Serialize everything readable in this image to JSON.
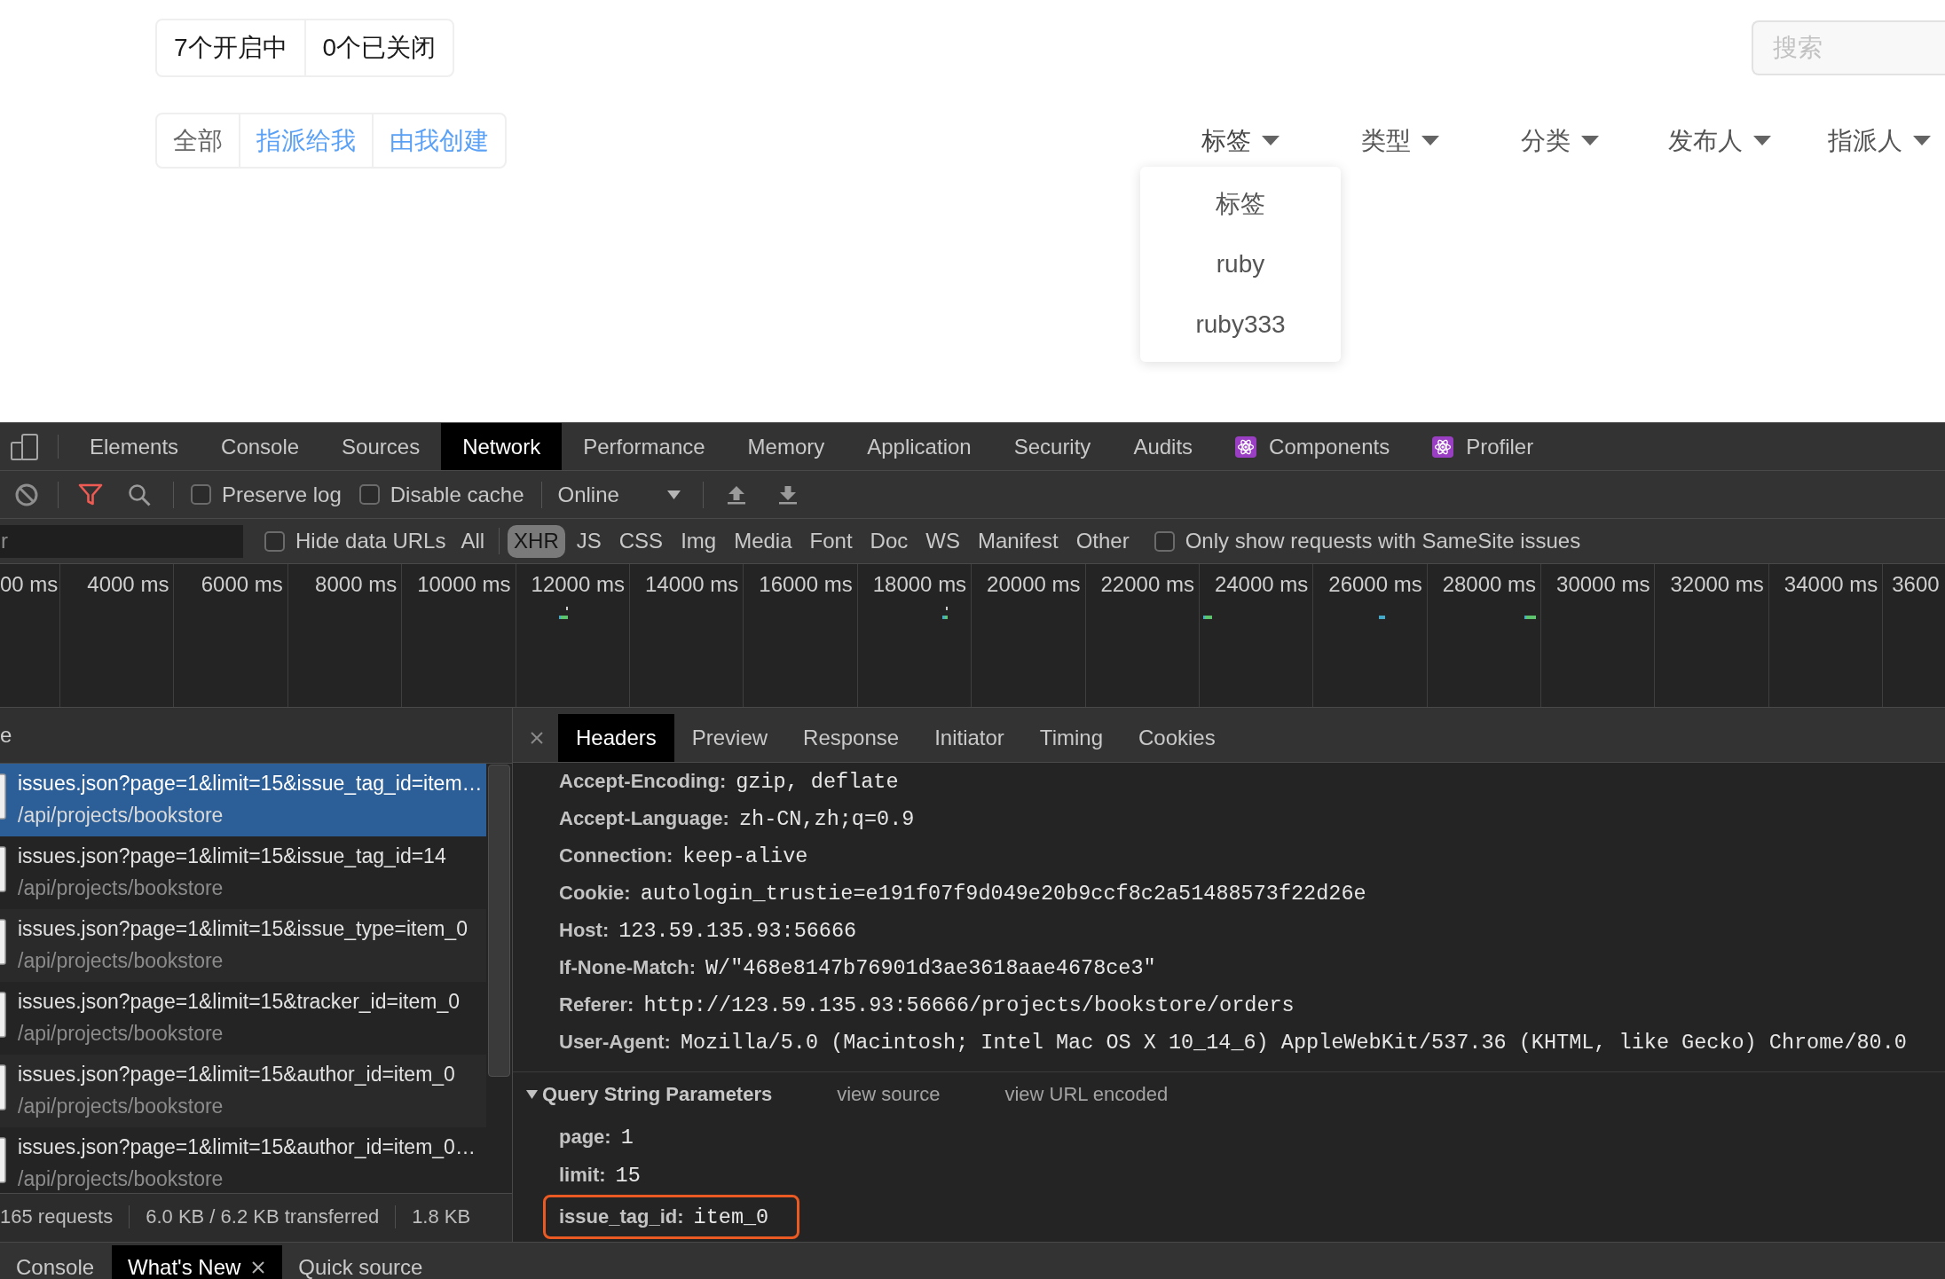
{
  "app": {
    "issue_counts": [
      "7个开启中",
      "0个已关闭"
    ],
    "search": {
      "placeholder": "搜索"
    },
    "scopes": [
      {
        "label": "全部",
        "selected": true
      },
      {
        "label": "指派给我",
        "selected": false
      },
      {
        "label": "由我创建",
        "selected": false
      }
    ],
    "filters": [
      {
        "label": "标签",
        "expanded": true,
        "options": [
          "标签",
          "ruby",
          "ruby333"
        ]
      },
      {
        "label": "类型",
        "expanded": false
      },
      {
        "label": "分类",
        "expanded": false
      },
      {
        "label": "发布人",
        "expanded": false
      },
      {
        "label": "指派人",
        "expanded": false
      }
    ]
  },
  "devtools": {
    "panel_tabs": [
      {
        "label": "Elements",
        "kind": "builtin",
        "selected": false
      },
      {
        "label": "Console",
        "kind": "builtin",
        "selected": false
      },
      {
        "label": "Sources",
        "kind": "builtin",
        "selected": false
      },
      {
        "label": "Network",
        "kind": "builtin",
        "selected": true
      },
      {
        "label": "Performance",
        "kind": "builtin",
        "selected": false
      },
      {
        "label": "Memory",
        "kind": "builtin",
        "selected": false
      },
      {
        "label": "Application",
        "kind": "builtin",
        "selected": false
      },
      {
        "label": "Security",
        "kind": "builtin",
        "selected": false
      },
      {
        "label": "Audits",
        "kind": "builtin",
        "selected": false
      },
      {
        "label": "Components",
        "kind": "extension",
        "selected": false
      },
      {
        "label": "Profiler",
        "kind": "extension",
        "selected": false
      }
    ],
    "toolbar": {
      "preserve_log": {
        "label": "Preserve log",
        "checked": false
      },
      "disable_cache": {
        "label": "Disable cache",
        "checked": false
      },
      "throttling": "Online"
    },
    "filter_bar": {
      "placeholder": "r",
      "hide_data_urls": {
        "label": "Hide data URLs",
        "checked": false
      },
      "types": [
        {
          "label": "All",
          "selected": false
        },
        {
          "label": "XHR",
          "selected": true
        },
        {
          "label": "JS",
          "selected": false
        },
        {
          "label": "CSS",
          "selected": false
        },
        {
          "label": "Img",
          "selected": false
        },
        {
          "label": "Media",
          "selected": false
        },
        {
          "label": "Font",
          "selected": false
        },
        {
          "label": "Doc",
          "selected": false
        },
        {
          "label": "WS",
          "selected": false
        },
        {
          "label": "Manifest",
          "selected": false
        },
        {
          "label": "Other",
          "selected": false
        }
      ],
      "samesite": {
        "label": "Only show requests with SameSite issues",
        "checked": false
      }
    },
    "overview": {
      "ticks": [
        "00 ms",
        "4000 ms",
        "6000 ms",
        "8000 ms",
        "10000 ms",
        "12000 ms",
        "14000 ms",
        "16000 ms",
        "18000 ms",
        "20000 ms",
        "22000 ms",
        "24000 ms",
        "26000 ms",
        "28000 ms",
        "30000 ms",
        "32000 ms",
        "34000 ms",
        "3600"
      ]
    },
    "requests": {
      "column_1": "e",
      "rows": [
        {
          "name": "issues.json?page=1&limit=15&issue_tag_id=item…",
          "path": "/api/projects/bookstore",
          "selected": true
        },
        {
          "name": "issues.json?page=1&limit=15&issue_tag_id=14",
          "path": "/api/projects/bookstore",
          "selected": false
        },
        {
          "name": "issues.json?page=1&limit=15&issue_type=item_0",
          "path": "/api/projects/bookstore",
          "selected": false
        },
        {
          "name": "issues.json?page=1&limit=15&tracker_id=item_0",
          "path": "/api/projects/bookstore",
          "selected": false
        },
        {
          "name": "issues.json?page=1&limit=15&author_id=item_0",
          "path": "/api/projects/bookstore",
          "selected": false
        },
        {
          "name": "issues.json?page=1&limit=15&author_id=item_0…",
          "path": "/api/projects/bookstore",
          "selected": false
        }
      ]
    },
    "summary": [
      "165 requests",
      "6.0 KB / 6.2 KB transferred",
      "1.8 KB"
    ],
    "details": {
      "tabs": [
        {
          "label": "Headers",
          "selected": true
        },
        {
          "label": "Preview",
          "selected": false
        },
        {
          "label": "Response",
          "selected": false
        },
        {
          "label": "Initiator",
          "selected": false
        },
        {
          "label": "Timing",
          "selected": false
        },
        {
          "label": "Cookies",
          "selected": false
        }
      ],
      "headers": [
        {
          "name": "Accept-Encoding:",
          "value": "gzip, deflate"
        },
        {
          "name": "Accept-Language:",
          "value": "zh-CN,zh;q=0.9"
        },
        {
          "name": "Connection:",
          "value": "keep-alive"
        },
        {
          "name": "Cookie:",
          "value": "autologin_trustie=e191f07f9d049e20b9ccf8c2a51488573f22d26e"
        },
        {
          "name": "Host:",
          "value": "123.59.135.93:56666"
        },
        {
          "name": "If-None-Match:",
          "value": "W/\"468e8147b76901d3ae3618aae4678ce3\""
        },
        {
          "name": "Referer:",
          "value": "http://123.59.135.93:56666/projects/bookstore/orders"
        },
        {
          "name": "User-Agent:",
          "value": "Mozilla/5.0 (Macintosh; Intel Mac OS X 10_14_6) AppleWebKit/537.36 (KHTML, like Gecko) Chrome/80.0"
        }
      ],
      "query": {
        "title": "Query String Parameters",
        "expanded": true,
        "links": [
          "view source",
          "view URL encoded"
        ],
        "params": [
          {
            "name": "page:",
            "value": "1",
            "highlighted": false
          },
          {
            "name": "limit:",
            "value": "15",
            "highlighted": false
          },
          {
            "name": "issue_tag_id:",
            "value": "item_0",
            "highlighted": true
          }
        ]
      }
    },
    "drawer_tabs": [
      {
        "label": "Console",
        "selected": false,
        "closable": false
      },
      {
        "label": "What's New",
        "selected": true,
        "closable": true
      },
      {
        "label": "Quick source",
        "selected": false,
        "closable": false
      }
    ]
  }
}
